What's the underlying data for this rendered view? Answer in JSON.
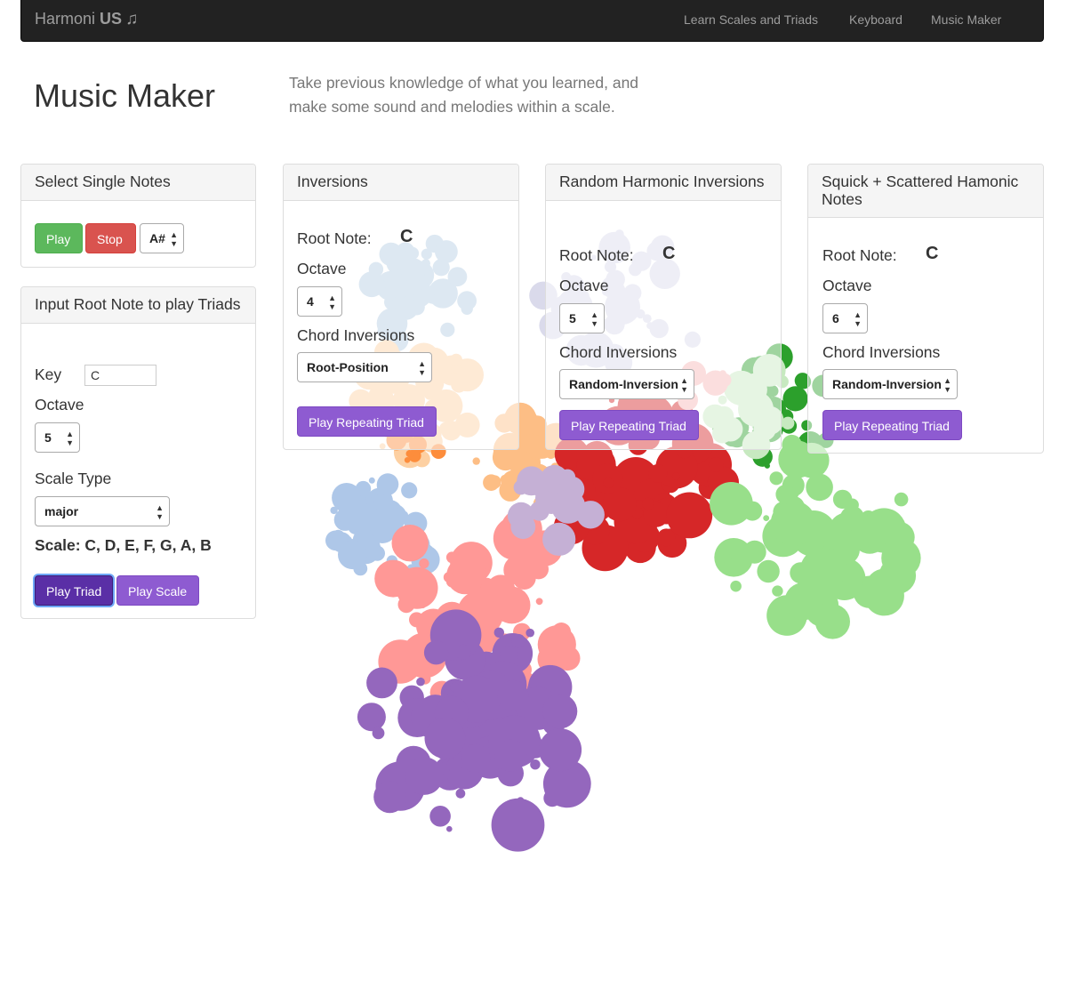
{
  "navbar": {
    "brand_prefix": "Harmoni",
    "brand_bold": "US",
    "brand_icon": "♫",
    "links": [
      "Learn Scales and Triads",
      "Keyboard",
      "Music Maker"
    ]
  },
  "header": {
    "title": "Music Maker",
    "intro": "Take previous knowledge of what you learned, and make some sound and melodies within a scale."
  },
  "single_notes": {
    "heading": "Select Single Notes",
    "play_label": "Play",
    "stop_label": "Stop",
    "note_value": "A#"
  },
  "triads": {
    "heading": "Input Root Note to play Triads",
    "key_label": "Key",
    "key_value": "C",
    "octave_label": "Octave",
    "octave_value": "5",
    "scale_type_label": "Scale Type",
    "scale_type_value": "major",
    "scale_text": "Scale: C, D, E, F, G, A, B",
    "play_triad_label": "Play Triad",
    "play_scale_label": "Play Scale"
  },
  "inversions": {
    "heading": "Inversions",
    "root_label": "Root Note:",
    "root_value": "C",
    "octave_label": "Octave",
    "octave_value": "4",
    "chord_label": "Chord Inversions",
    "chord_value": "Root-Position",
    "button_label": "Play Repeating Triad"
  },
  "random_inversions": {
    "heading": "Random Harmonic Inversions",
    "root_label": "Root Note:",
    "root_value": "C",
    "octave_label": "Octave",
    "octave_value": "5",
    "chord_label": "Chord Inversions",
    "chord_value": "Random-Inversion",
    "button_label": "Play Repeating Triad"
  },
  "scattered": {
    "heading": "Squick + Scattered Hamonic Notes",
    "root_label": "Root Note:",
    "root_value": "C",
    "octave_label": "Octave",
    "octave_value": "6",
    "chord_label": "Chord Inversions",
    "chord_value": "Random-Inversion",
    "button_label": "Play Repeating Triad"
  },
  "visualization": {
    "clusters": [
      {
        "name": "light-blue-top",
        "color": "#b3cde3"
      },
      {
        "name": "lavender",
        "color": "#dadaeb"
      },
      {
        "name": "light-orange",
        "color": "#fdd0a2"
      },
      {
        "name": "orange",
        "color": "#fd8d3c"
      },
      {
        "name": "light-orange-2",
        "color": "#fdbe85"
      },
      {
        "name": "red",
        "color": "#d62728"
      },
      {
        "name": "green",
        "color": "#2ca02c"
      },
      {
        "name": "light-green",
        "color": "#98df8a"
      },
      {
        "name": "pale-green",
        "color": "#c7e9c0"
      },
      {
        "name": "pink",
        "color": "#f7b6b6"
      },
      {
        "name": "light-blue",
        "color": "#aec7e8"
      },
      {
        "name": "mid-orange",
        "color": "#fdae6b"
      },
      {
        "name": "salmon",
        "color": "#ff9896"
      },
      {
        "name": "purple",
        "color": "#9467bd"
      },
      {
        "name": "light-purple",
        "color": "#c5b0d5"
      }
    ]
  }
}
